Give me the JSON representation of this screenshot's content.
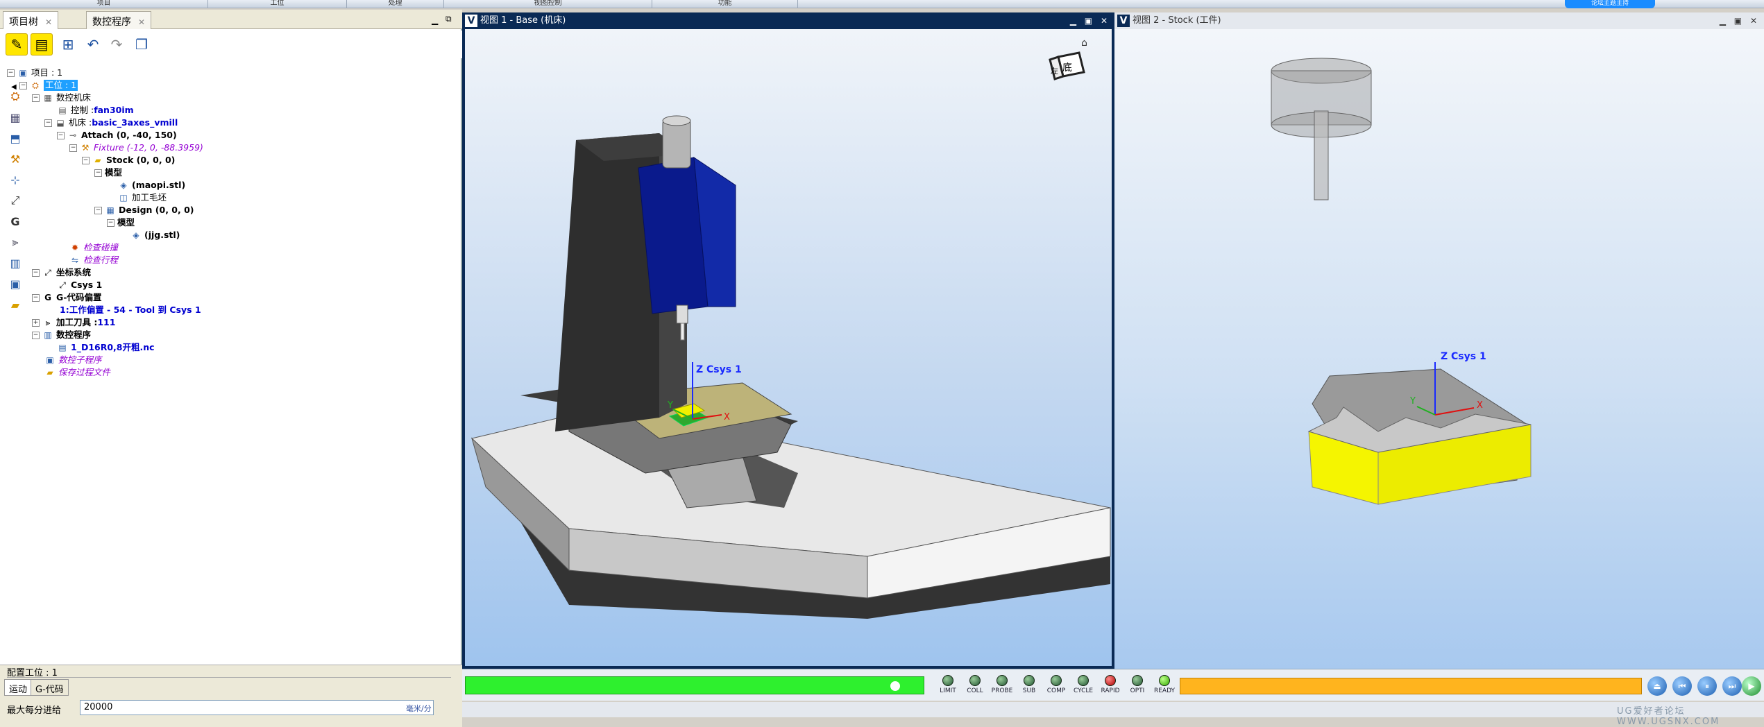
{
  "menubar": {
    "items": [
      "项目",
      "工位",
      "处理",
      "视图控制",
      "功能"
    ],
    "badge": "论坛主题主持"
  },
  "left_tabs": {
    "project_tree": "项目树",
    "nc_program": "数控程序"
  },
  "tree": {
    "project": "项目 : 1",
    "setup": "工位 : 1",
    "nc_machine": "数控机床",
    "control_label": "控制 : ",
    "control_value": "fan30im",
    "machine_label": "机床 : ",
    "machine_value": "basic_3axes_vmill",
    "attach": "Attach (0, -40, 150)",
    "fixture": "Fixture (-12, 0, -88.3959)",
    "stock": "Stock (0, 0, 0)",
    "model1": "模型",
    "maopi": "(maopi.stl)",
    "blank": "加工毛坯",
    "design": "Design (0, 0, 0)",
    "model2": "模型",
    "jig": "(jjg.stl)",
    "collision": "检查碰撞",
    "travel": "检查行程",
    "csys_group": "坐标系统",
    "csys1": "Csys 1",
    "gcode_offset": "G-代码偏置",
    "work_offset": "1:工作偏置 - 54 - Tool 到 Csys 1",
    "tools_label": "加工刀具 : ",
    "tools_value": "111",
    "nc_programs": "数控程序",
    "nc_file": "1_D16R0,8开粗.nc",
    "subprograms": "数控子程序",
    "save_process": "保存过程文件"
  },
  "config": {
    "title": "配置工位 : 1",
    "tab_motion": "运动",
    "tab_gcode": "G-代码",
    "feed_label": "最大每分进给",
    "feed_value": "20000",
    "feed_unit": "毫米/分"
  },
  "viewport1": {
    "title": "视图 1 - Base (机床)",
    "csys": "Z Csys 1",
    "axis_x": "X",
    "axis_y": "Y",
    "cube_a": "左",
    "cube_b": "底"
  },
  "viewport2": {
    "title": "视图 2 - Stock (工件)",
    "csys": "Z Csys 1",
    "axis_x": "X",
    "axis_y": "Y"
  },
  "leds": [
    "LIMIT",
    "COLL",
    "PROBE",
    "SUB",
    "COMP",
    "CYCLE",
    "RAPID",
    "OPTI",
    "READY"
  ],
  "watermark": "UG爱好者论坛 WWW.UGSNX.COM",
  "colors": {
    "progress_green": "#2ef02e",
    "progress_orange": "#ffb41e",
    "stock_yellow": "#f5f500",
    "spindle_blue": "#0a1a8c"
  }
}
